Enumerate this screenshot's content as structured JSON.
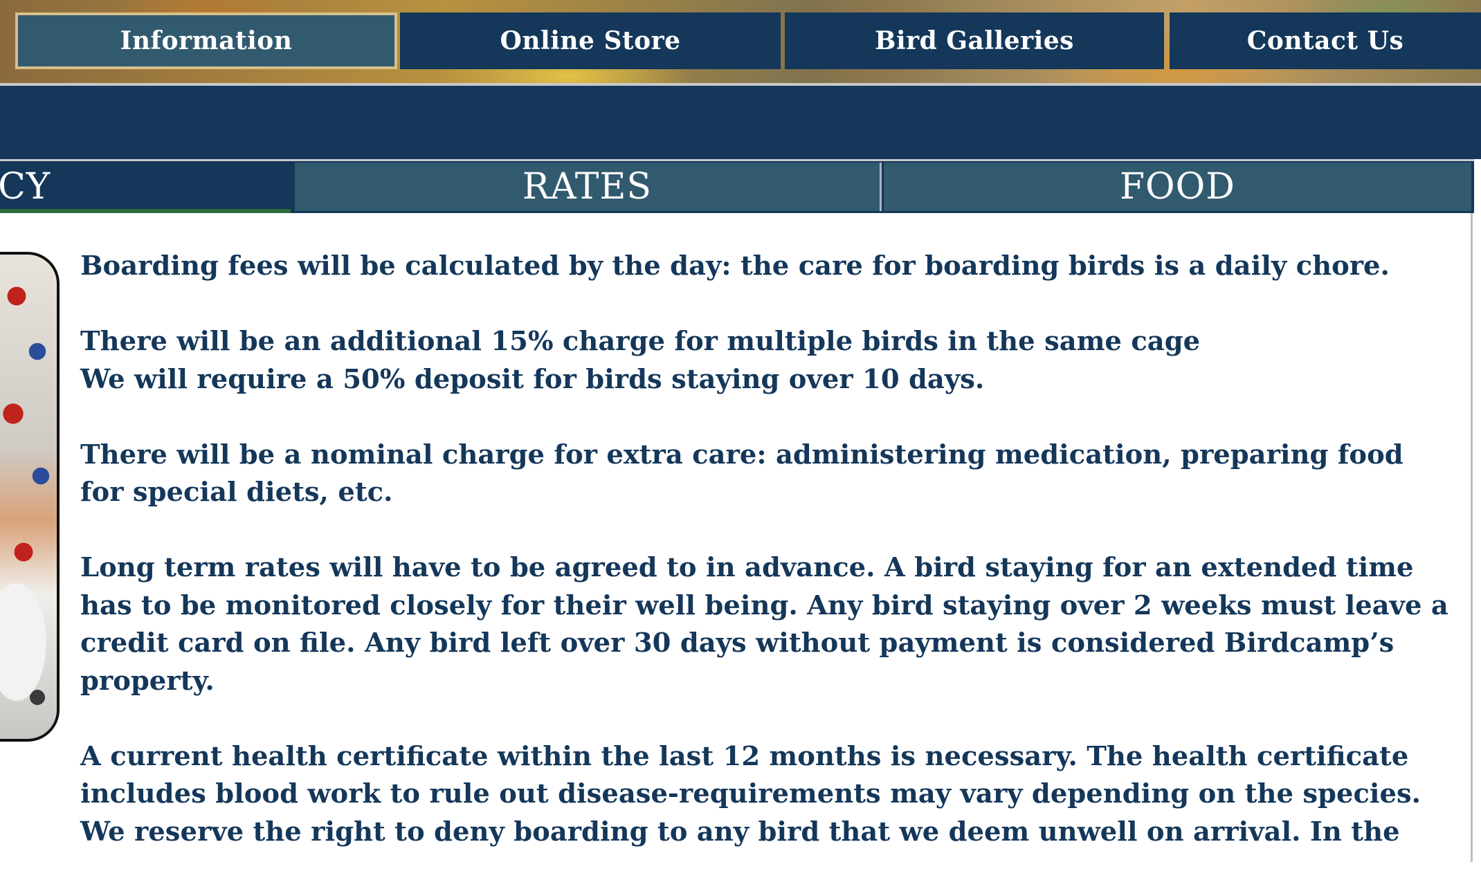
{
  "top_nav": {
    "items": [
      {
        "label": "Information",
        "active": true
      },
      {
        "label": "Online Store",
        "active": false
      },
      {
        "label": "Bird Galleries",
        "active": false
      },
      {
        "label": "Contact Us",
        "active": false
      }
    ]
  },
  "sub_nav": {
    "items": [
      {
        "label": "LICY"
      },
      {
        "label": "RATES"
      },
      {
        "label": "FOOD"
      }
    ]
  },
  "content": {
    "paragraphs": [
      "Boarding fees will be calculated by the day: the care for boarding birds is a daily chore.",
      "There will be an additional 15% charge for multiple birds in the same cage\nWe will require a 50% deposit for birds staying over 10 days.",
      "There will be a nominal charge for extra care: administering medication, preparing food for special diets, etc.",
      "Long term rates will have to be agreed to in advance.  A bird staying for an extended time has to be monitored closely for their well being.  Any bird staying over 2 weeks must leave a credit card on file.  Any bird left over 30 days without payment is considered Birdcamp’s property.",
      "A current health certificate within the last 12 months is necessary. The health certificate includes blood work to rule out disease-requirements may vary depending on the species. We reserve the right to deny boarding to any bird that we deem unwell on arrival. In the"
    ]
  },
  "colors": {
    "navy": "#14375a",
    "active_tab": "#325a6f",
    "text": "#14375a"
  }
}
